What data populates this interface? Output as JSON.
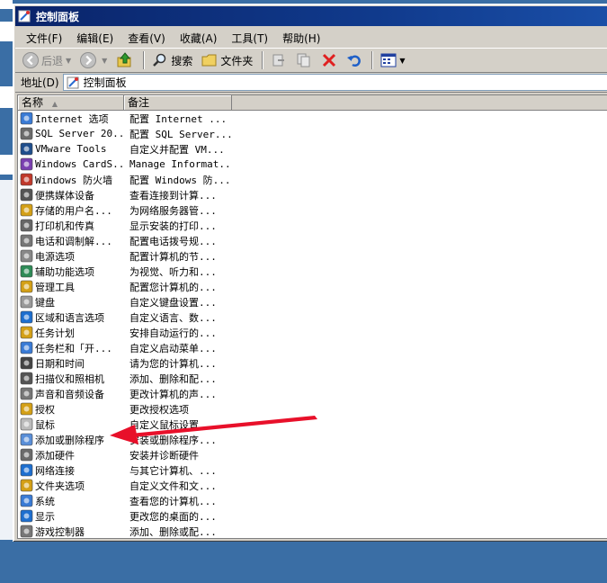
{
  "window": {
    "title": "控制面板"
  },
  "menu": [
    {
      "label": "文件(F)"
    },
    {
      "label": "编辑(E)"
    },
    {
      "label": "查看(V)"
    },
    {
      "label": "收藏(A)"
    },
    {
      "label": "工具(T)"
    },
    {
      "label": "帮助(H)"
    }
  ],
  "toolbar": {
    "back_label": "后退",
    "search_label": "搜索",
    "folders_label": "文件夹"
  },
  "address": {
    "label": "地址(D)",
    "value": "控制面板"
  },
  "columns": {
    "name": "名称",
    "desc": "备注"
  },
  "items": [
    {
      "name": "Internet 选项",
      "desc": "配置 Internet ...",
      "icon": "internet-options-icon",
      "color": "#3a7bd5"
    },
    {
      "name": "SQL Server 20...",
      "desc": "配置 SQL Server...",
      "icon": "sql-server-icon",
      "color": "#6b6b6b"
    },
    {
      "name": "VMware Tools",
      "desc": "自定义并配置 VM...",
      "icon": "vmware-icon",
      "color": "#1f4e8c"
    },
    {
      "name": "Windows CardS...",
      "desc": "Manage Informat...",
      "icon": "cardspace-icon",
      "color": "#7a3fb0"
    },
    {
      "name": "Windows 防火墙",
      "desc": "配置 Windows 防...",
      "icon": "firewall-icon",
      "color": "#c0392b"
    },
    {
      "name": "便携媒体设备",
      "desc": "查看连接到计算...",
      "icon": "portable-device-icon",
      "color": "#555555"
    },
    {
      "name": "存储的用户名...",
      "desc": "为网络服务器管...",
      "icon": "stored-users-icon",
      "color": "#d4a017"
    },
    {
      "name": "打印机和传真",
      "desc": "显示安装的打印...",
      "icon": "printer-icon",
      "color": "#666666"
    },
    {
      "name": "电话和调制解...",
      "desc": "配置电话拨号规...",
      "icon": "phone-icon",
      "color": "#777777"
    },
    {
      "name": "电源选项",
      "desc": "配置计算机的节...",
      "icon": "power-icon",
      "color": "#888888"
    },
    {
      "name": "辅助功能选项",
      "desc": "为视觉、听力和...",
      "icon": "accessibility-icon",
      "color": "#2e8b57"
    },
    {
      "name": "管理工具",
      "desc": "配置您计算机的...",
      "icon": "admin-tools-icon",
      "color": "#d4a017"
    },
    {
      "name": "键盘",
      "desc": "自定义键盘设置...",
      "icon": "keyboard-icon",
      "color": "#999999"
    },
    {
      "name": "区域和语言选项",
      "desc": "自定义语言、数...",
      "icon": "region-icon",
      "color": "#1e6fcf"
    },
    {
      "name": "任务计划",
      "desc": "安排自动运行的...",
      "icon": "scheduled-tasks-icon",
      "color": "#d4a017"
    },
    {
      "name": "任务栏和「开...",
      "desc": "自定义启动菜单...",
      "icon": "taskbar-icon",
      "color": "#3a7bd5"
    },
    {
      "name": "日期和时间",
      "desc": "请为您的计算机...",
      "icon": "clock-icon",
      "color": "#444444"
    },
    {
      "name": "扫描仪和照相机",
      "desc": "添加、删除和配...",
      "icon": "scanner-icon",
      "color": "#555555"
    },
    {
      "name": "声音和音频设备",
      "desc": "更改计算机的声...",
      "icon": "sound-icon",
      "color": "#777777"
    },
    {
      "name": "授权",
      "desc": "更改授权选项",
      "icon": "license-icon",
      "color": "#d4a017"
    },
    {
      "name": "鼠标",
      "desc": "自定义鼠标设置",
      "icon": "mouse-icon",
      "color": "#bbbbbb"
    },
    {
      "name": "添加或删除程序",
      "desc": "安装或删除程序...",
      "icon": "add-remove-programs-icon",
      "color": "#5a8fd8"
    },
    {
      "name": "添加硬件",
      "desc": "安装并诊断硬件",
      "icon": "add-hardware-icon",
      "color": "#6b6b6b"
    },
    {
      "name": "网络连接",
      "desc": "与其它计算机、...",
      "icon": "network-icon",
      "color": "#1e6fcf"
    },
    {
      "name": "文件夹选项",
      "desc": "自定义文件和文...",
      "icon": "folder-options-icon",
      "color": "#d4a017"
    },
    {
      "name": "系统",
      "desc": "查看您的计算机...",
      "icon": "system-icon",
      "color": "#3a7bd5"
    },
    {
      "name": "显示",
      "desc": "更改您的桌面的...",
      "icon": "display-icon",
      "color": "#1e6fcf"
    },
    {
      "name": "游戏控制器",
      "desc": "添加、删除或配...",
      "icon": "game-controller-icon",
      "color": "#777777"
    }
  ],
  "colors": {
    "title_bar": "#0a246a",
    "annotation_arrow": "#e8102a",
    "desktop": "#3a6ea5"
  }
}
